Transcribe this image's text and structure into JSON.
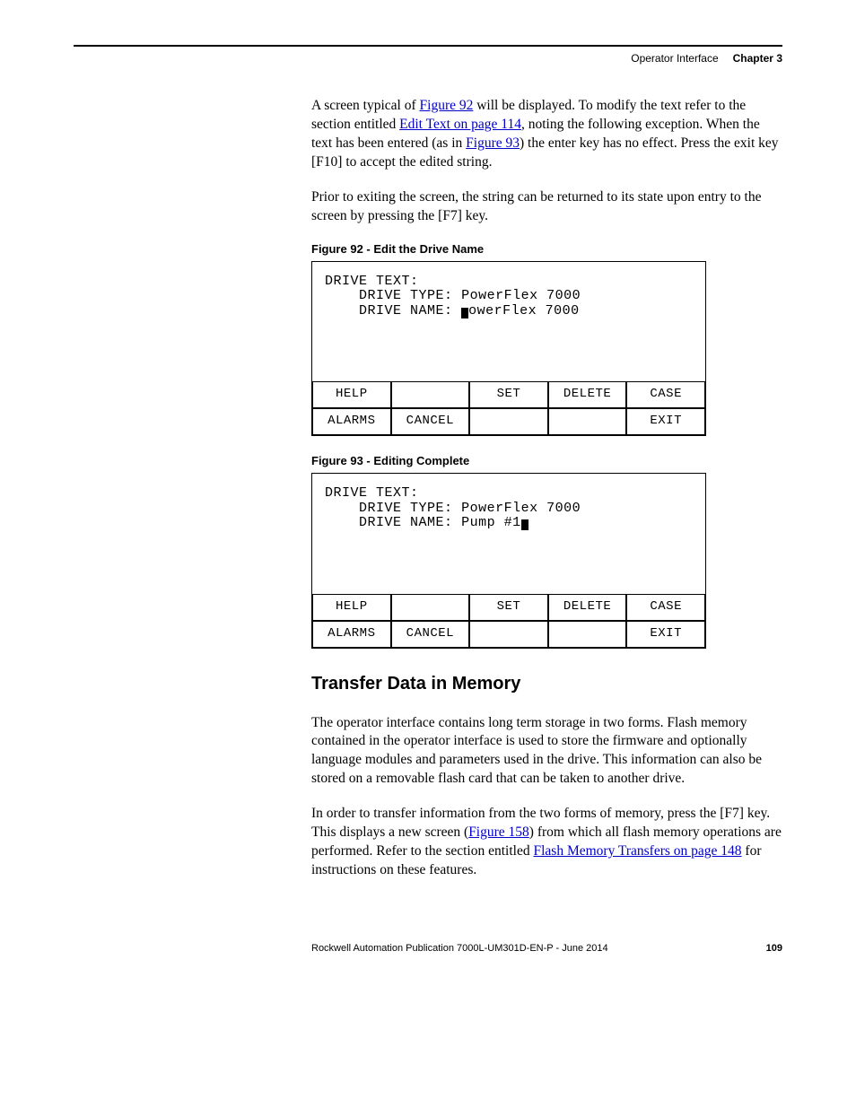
{
  "header": {
    "section": "Operator Interface",
    "chapter": "Chapter 3"
  },
  "paragraphs": {
    "p1a": "A screen typical of ",
    "p1_link1": "Figure 92",
    "p1b": " will be displayed. To modify the text refer to the section entitled ",
    "p1_link2": "Edit Text on page 114",
    "p1c": ", noting the following exception. When the text has been entered (as in ",
    "p1_link3": "Figure 93",
    "p1d": ") the enter key has no effect. Press the exit key [F10] to accept the edited string.",
    "p2": "Prior to exiting the screen, the string can be returned to its state upon entry to the screen by pressing the [F7] key.",
    "p3": "The operator interface contains long term storage in two forms. Flash memory contained in the operator interface is used to store the firmware and optionally language modules and parameters used in the drive. This information can also be stored on a removable flash card that can be taken to another drive.",
    "p4a": "In order to transfer information from the two forms of memory, press the [F7] key. This displays a new screen (",
    "p4_link1": "Figure 158",
    "p4b": ") from which all flash memory operations are performed. Refer to the section entitled ",
    "p4_link2": "Flash Memory Transfers on page 148",
    "p4c": " for instructions on these features."
  },
  "figures": {
    "f92_caption": "Figure 92 - Edit the Drive Name",
    "f93_caption": "Figure 93 - Editing Complete"
  },
  "screen92": {
    "title": "DRIVE TEXT:",
    "line_type_label": "DRIVE TYPE:",
    "line_type_value": "PowerFlex 7000",
    "line_name_label": "DRIVE NAME:",
    "line_name_value": "owerFlex 7000",
    "keys": {
      "k1": "HELP",
      "k2": "",
      "k3": "SET",
      "k4": "DELETE",
      "k5": "CASE",
      "k6": "ALARMS",
      "k7": "CANCEL",
      "k8": "",
      "k9": "",
      "k10": "EXIT"
    }
  },
  "screen93": {
    "title": "DRIVE TEXT:",
    "line_type_label": "DRIVE TYPE:",
    "line_type_value": "PowerFlex 7000",
    "line_name_label": "DRIVE NAME:",
    "line_name_value": "Pump #1",
    "keys": {
      "k1": "HELP",
      "k2": "",
      "k3": "SET",
      "k4": "DELETE",
      "k5": "CASE",
      "k6": "ALARMS",
      "k7": "CANCEL",
      "k8": "",
      "k9": "",
      "k10": "EXIT"
    }
  },
  "heading": {
    "transfer": "Transfer Data in Memory"
  },
  "footer": {
    "pub": "Rockwell Automation Publication 7000L-UM301D-EN-P - June 2014",
    "page": "109"
  }
}
